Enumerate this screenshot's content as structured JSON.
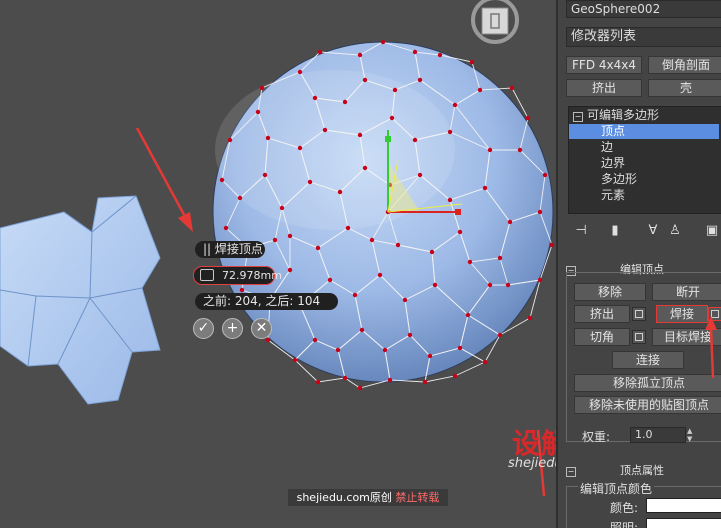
{
  "viewport": {
    "caddy_title": "焊接顶点",
    "caddy_value": "72.978mm",
    "caddy_stats": "之前: 204, 之后: 104",
    "ok_glyph": "✓",
    "apply_glyph": "+",
    "cancel_glyph": "✕",
    "watermark_site": "shejiedu.com",
    "watermark_original": "原创",
    "watermark_warning": "禁止转载",
    "logo_text": "设解读",
    "logo_url": "shejiedu.com",
    "colors": {
      "mesh": "#a8c4ee",
      "vertex": "#c80018",
      "annotation": "#e53935"
    }
  },
  "panel": {
    "object_name": "GeoSphere002",
    "modifier_list": "修改器列表",
    "buttons_row1": [
      "FFD 4x4x4",
      "倒角剖面"
    ],
    "buttons_row2": [
      "挤出",
      "壳"
    ],
    "stack": {
      "root": "可编辑多边形",
      "items": [
        "顶点",
        "边",
        "边界",
        "多边形",
        "元素"
      ],
      "selected": "顶点"
    },
    "tools": [
      "pin-stack",
      "show-end-result",
      "make-unique",
      "remove-modifier",
      "configure-sets"
    ],
    "edit_vertices": {
      "title": "编辑顶点",
      "remove": "移除",
      "break": "断开",
      "extrude": "挤出",
      "weld": "焊接",
      "chamfer": "切角",
      "target_weld": "目标焊接",
      "connect": "连接",
      "remove_isolated": "移除孤立顶点",
      "remove_unused": "移除未使用的贴图顶点",
      "weight_label": "权重:",
      "weight_value": "1.0"
    },
    "vertex_properties": {
      "title": "顶点属性",
      "edit_color": "编辑顶点颜色",
      "color_label": "颜色:",
      "illum_label": "照明:"
    }
  }
}
